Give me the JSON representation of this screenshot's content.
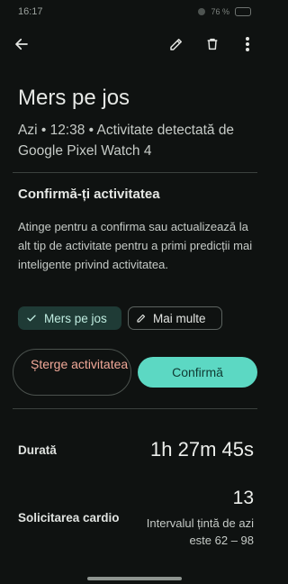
{
  "status_bar": {
    "time": "16:17",
    "battery": "76 %"
  },
  "title": "Mers pe jos",
  "subtitle": "Azi • 12:38 • Activitate detectată de Google Pixel Watch 4",
  "confirm_section": {
    "title": "Confirmă-ți activitatea",
    "description": "Atinge pentru a confirma sau actualizează la alt tip de activitate pentru a primi predicții mai inteligente privind activitatea.",
    "chips": {
      "selected": "Mers pe jos",
      "more": "Mai multe"
    },
    "delete_button": "Șterge activitatea",
    "confirm_button": "Confirmă"
  },
  "stats": {
    "duration": {
      "label": "Durată",
      "value": "1h 27m 45s"
    },
    "cardio": {
      "label": "Solicitarea cardio",
      "value": "13",
      "note": "Intervalul țintă de azi este 62 – 98"
    }
  },
  "colors": {
    "background": "#0f1211",
    "accent": "#5cd8c3",
    "selected_chip": "#1f3b36",
    "destructive": "#f2a999"
  },
  "icons": [
    "back-arrow-icon",
    "edit-pencil-icon",
    "trash-icon",
    "more-vertical-icon",
    "check-icon",
    "pencil-icon"
  ]
}
